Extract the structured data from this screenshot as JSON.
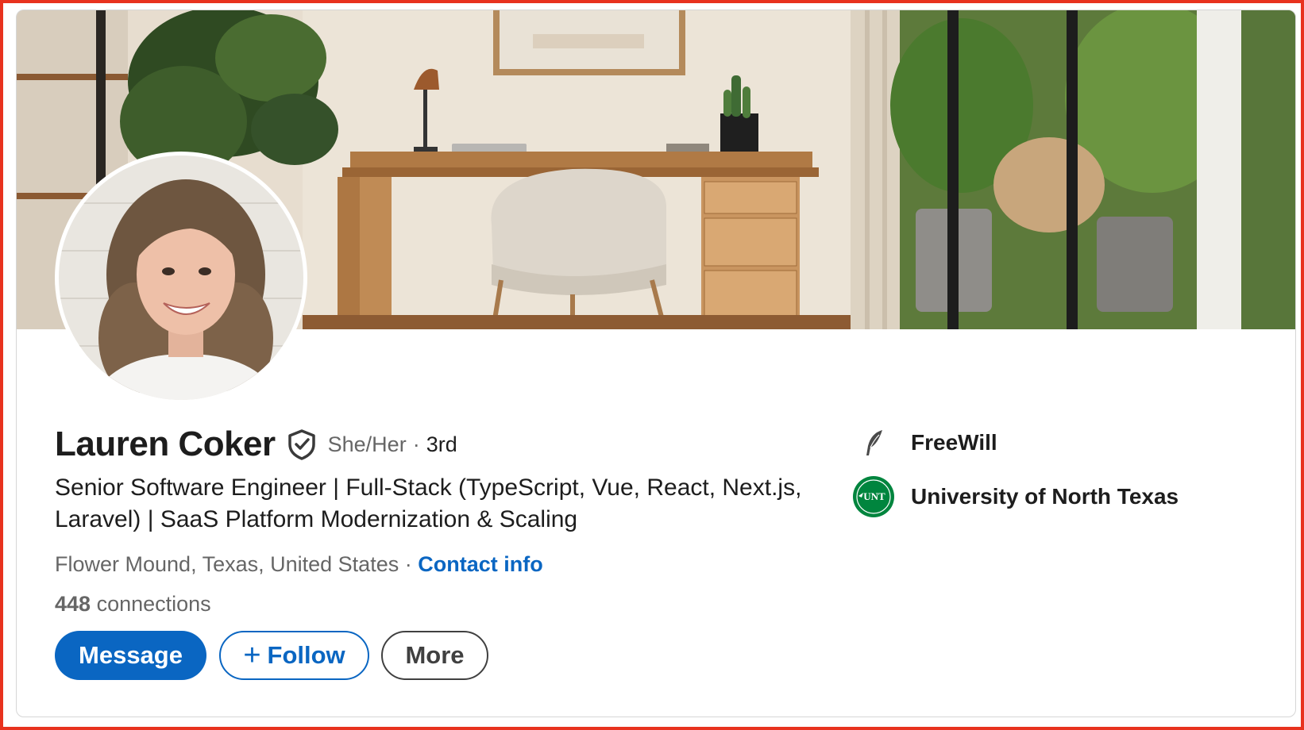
{
  "profile": {
    "name": "Lauren Coker",
    "pronouns": "She/Her",
    "degree_separator": "·",
    "degree": "3rd",
    "headline": "Senior Software Engineer | Full-Stack (TypeScript, Vue, React, Next.js, Laravel) | SaaS Platform Modernization & Scaling",
    "location": "Flower Mound, Texas, United States",
    "location_separator": "·",
    "contact_label": "Contact info",
    "connections_count": "448",
    "connections_label": "connections"
  },
  "actions": {
    "message_label": "Message",
    "follow_plus": "+",
    "follow_label": "Follow",
    "more_label": "More"
  },
  "affiliations": {
    "company": {
      "name": "FreeWill",
      "icon": "feather-quill-icon"
    },
    "school": {
      "name": "University of North Texas",
      "icon": "unt-logo",
      "logo_text": "UNT"
    }
  },
  "colors": {
    "accent": "#0a66c2",
    "frame": "#e8321e",
    "text_primary": "#1d1d1d",
    "text_secondary": "#666666",
    "unt_green": "#00853e"
  }
}
